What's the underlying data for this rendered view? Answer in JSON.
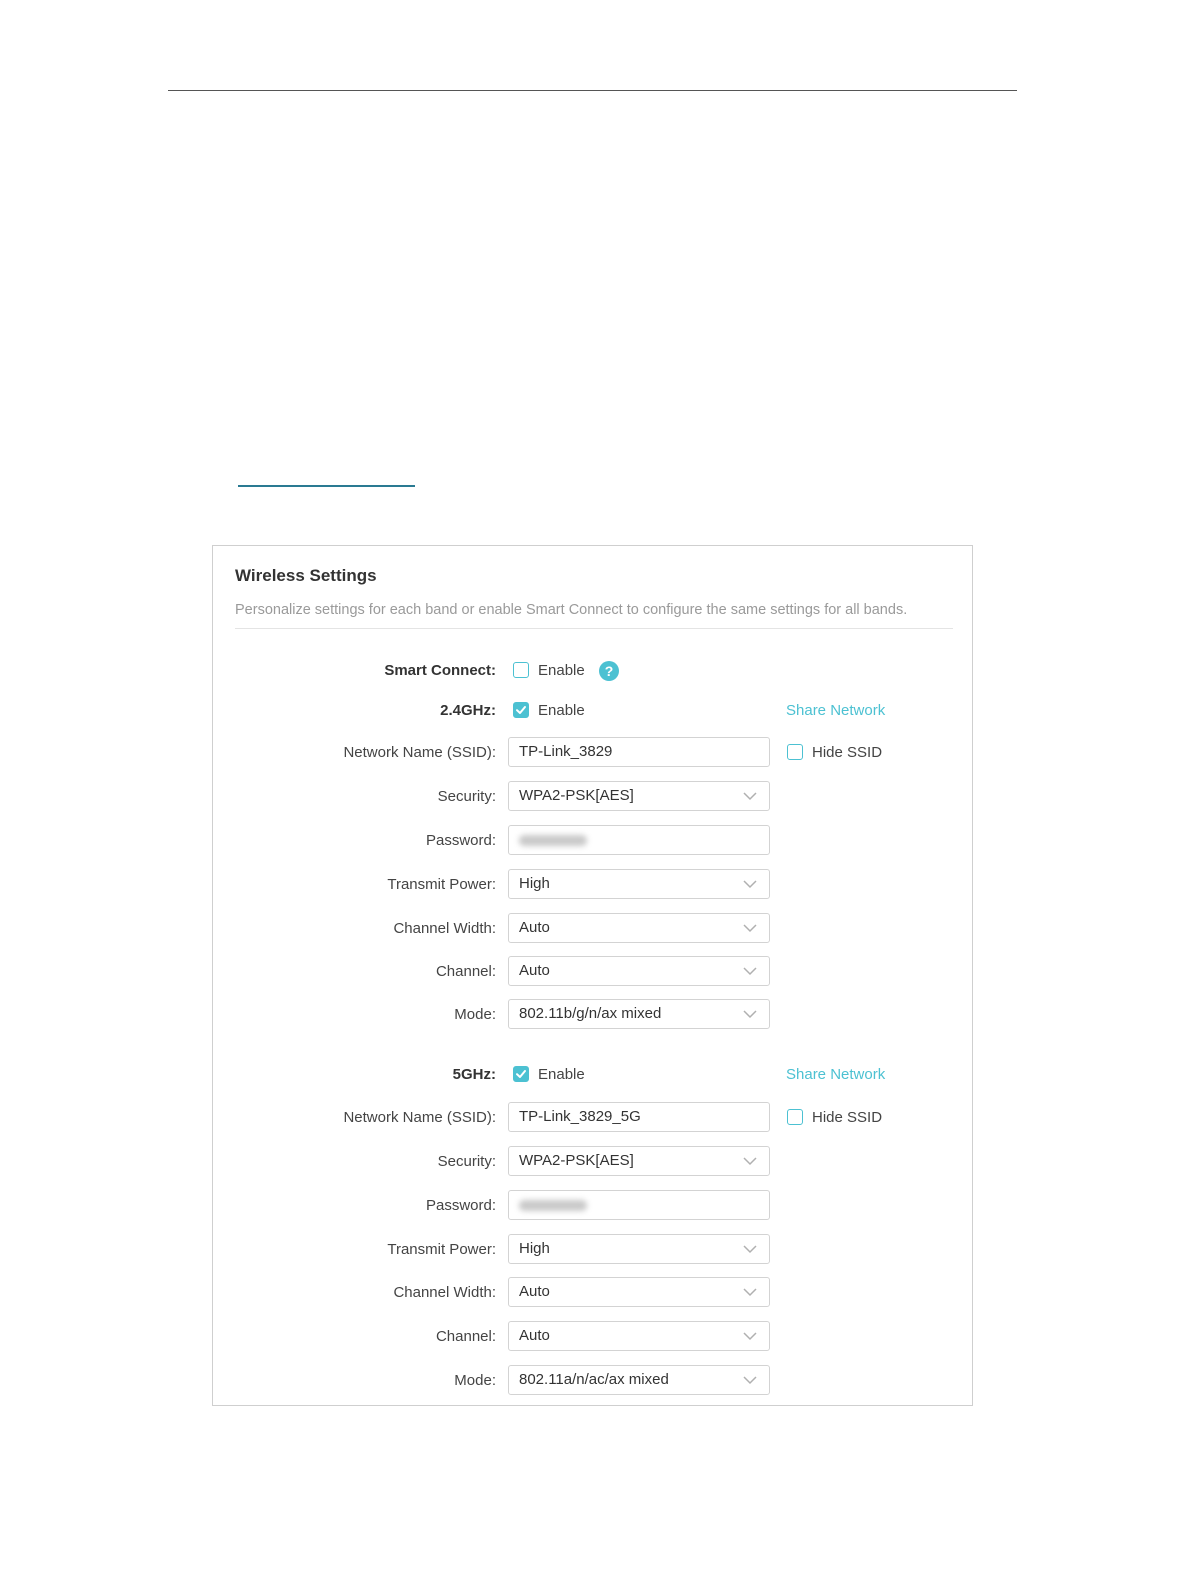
{
  "panel": {
    "title": "Wireless Settings",
    "description": "Personalize settings for each band or enable Smart Connect to configure the same settings for all bands."
  },
  "smart_connect": {
    "label": "Smart Connect:",
    "enable_label": "Enable",
    "checked": false,
    "help_icon": "question-mark-icon"
  },
  "band_24": {
    "label": "2.4GHz:",
    "enable_label": "Enable",
    "checked": true,
    "share_label": "Share Network",
    "ssid_label": "Network Name (SSID):",
    "ssid_value": "TP-Link_3829",
    "hide_ssid_label": "Hide SSID",
    "hide_ssid_checked": false,
    "security_label": "Security:",
    "security_value": "WPA2-PSK[AES]",
    "password_label": "Password:",
    "power_label": "Transmit Power:",
    "power_value": "High",
    "width_label": "Channel Width:",
    "width_value": "Auto",
    "channel_label": "Channel:",
    "channel_value": "Auto",
    "mode_label": "Mode:",
    "mode_value": "802.11b/g/n/ax mixed"
  },
  "band_5": {
    "label": "5GHz:",
    "enable_label": "Enable",
    "checked": true,
    "share_label": "Share Network",
    "ssid_label": "Network Name (SSID):",
    "ssid_value": "TP-Link_3829_5G",
    "hide_ssid_label": "Hide SSID",
    "hide_ssid_checked": false,
    "security_label": "Security:",
    "security_value": "WPA2-PSK[AES]",
    "password_label": "Password:",
    "power_label": "Transmit Power:",
    "power_value": "High",
    "width_label": "Channel Width:",
    "width_value": "Auto",
    "channel_label": "Channel:",
    "channel_value": "Auto",
    "mode_label": "Mode:",
    "mode_value": "802.11a/n/ac/ax mixed"
  },
  "colors": {
    "accent": "#4cc1d2",
    "border": "#d3d3d3",
    "muted_text": "#9a9a9a",
    "rule": "#2a7a92"
  }
}
